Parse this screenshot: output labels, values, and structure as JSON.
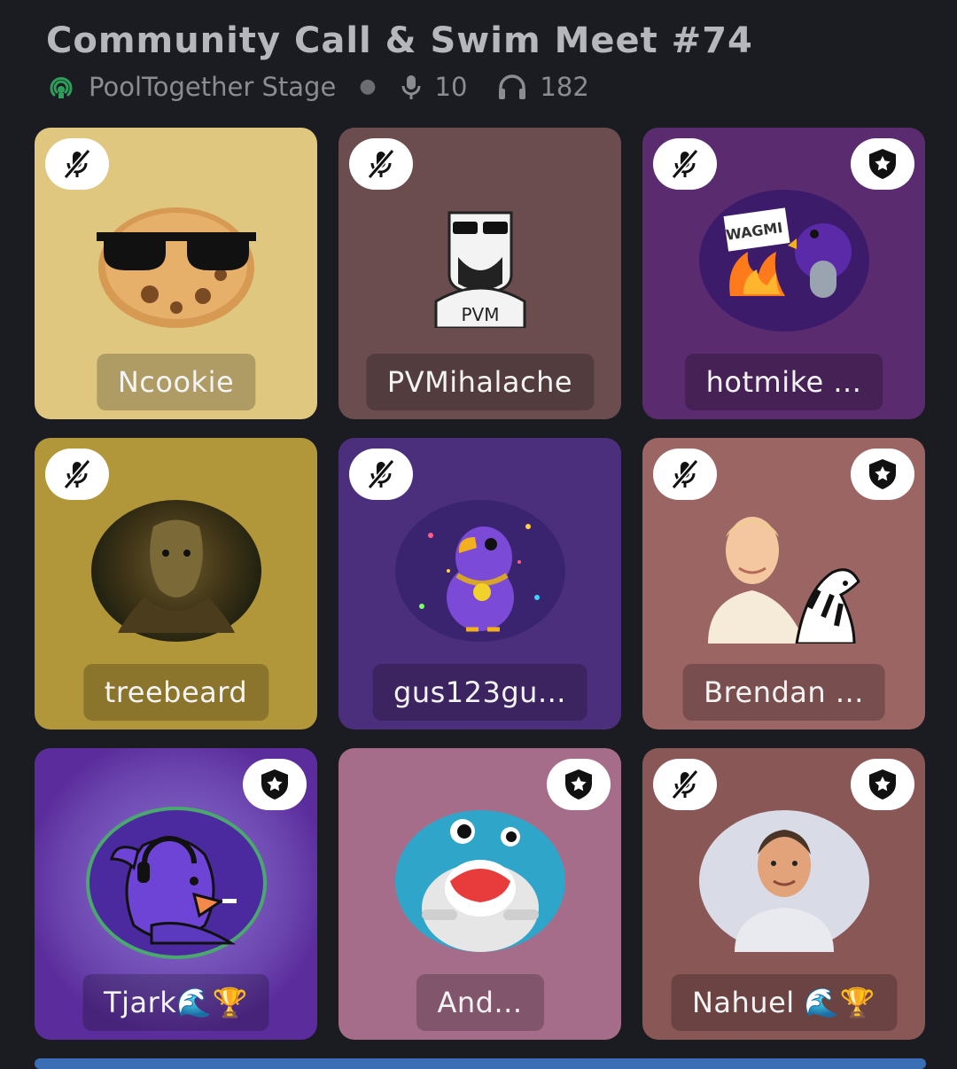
{
  "header": {
    "title": "Community Call & Swim Meet #74",
    "stage_name": "PoolTogether Stage",
    "speakers": "10",
    "listeners": "182"
  },
  "colors": {
    "stage_icon": "#2e9e5a",
    "bottom_bar": "#3b6fb5"
  },
  "participants": [
    {
      "name": "Ncookie",
      "muted": true,
      "moderator": false,
      "card_color": "#e0c780"
    },
    {
      "name": "PVMihalache",
      "muted": true,
      "moderator": false,
      "card_color": "#6b4d4f"
    },
    {
      "name": "hotmike ...",
      "muted": true,
      "moderator": true,
      "card_color": "#5a2b6f"
    },
    {
      "name": "treebeard",
      "muted": true,
      "moderator": false,
      "card_color": "#b2973a"
    },
    {
      "name": "gus123gu...",
      "muted": true,
      "moderator": false,
      "card_color": "#4c2f7c"
    },
    {
      "name": "Brendan ...",
      "muted": true,
      "moderator": true,
      "card_color": "#9b6564"
    },
    {
      "name": "Tjark🌊🏆",
      "muted": false,
      "moderator": true,
      "card_color": "#5b2d9c"
    },
    {
      "name": "And...",
      "muted": false,
      "moderator": true,
      "card_color": "#a66d8a"
    },
    {
      "name": "Nahuel 🌊🏆",
      "muted": true,
      "moderator": true,
      "card_color": "#8a5757"
    }
  ]
}
